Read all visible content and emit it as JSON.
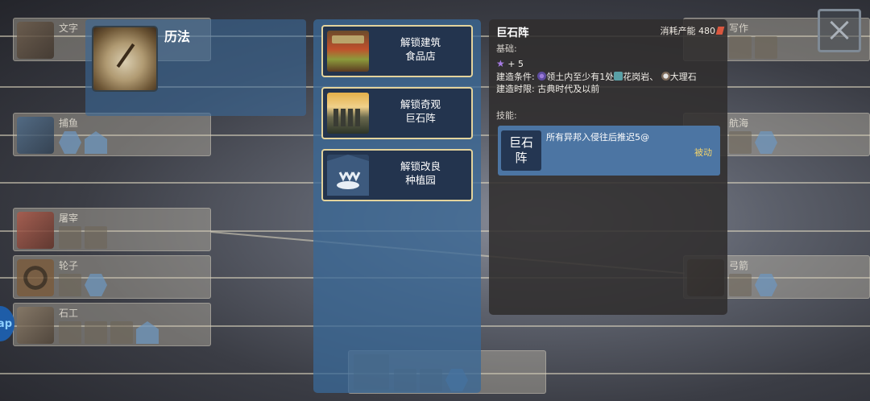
{
  "background_tree": {
    "left_cards": [
      {
        "name": "文字"
      },
      {
        "name": "捕鱼"
      },
      {
        "name": "屠宰"
      },
      {
        "name": "轮子"
      },
      {
        "name": "石工"
      }
    ],
    "right_cards": [
      {
        "name": "写作"
      },
      {
        "name": "航海"
      },
      {
        "name": "弓箭"
      }
    ],
    "side_badge": "ap"
  },
  "tech": {
    "title": "历法",
    "icon": "sundial-icon"
  },
  "unlocks": [
    {
      "line1": "解锁建筑",
      "line2": "食品店",
      "icon": "food-market-icon"
    },
    {
      "line1": "解锁奇观",
      "line2": "巨石阵",
      "icon": "stonehenge-icon"
    },
    {
      "line1": "解锁改良",
      "line2": "种植园",
      "icon": "plantation-icon"
    }
  ],
  "detail": {
    "title": "巨石阵",
    "cost_label": "消耗产能 480",
    "cost_icon": "hammer-icon",
    "basics_label": "基础:",
    "bonus_value": "+ 5",
    "bonus_icon": "star-icon",
    "condition_prefix": "建造条件: ",
    "condition_part1": "领土内至少有1处",
    "condition_part2": "花岗岩、",
    "condition_part3": "大理石",
    "limit_line": "建造时限: 古典时代及以前",
    "skills_label": "技能:",
    "skill": {
      "badge": "巨石阵",
      "description": "所有异邦入侵往后推迟5@",
      "type": "被动"
    }
  },
  "colors": {
    "accent_border": "#e3d39c",
    "panel_blue": "#3a6896",
    "skill_type": "#f4d46a"
  }
}
